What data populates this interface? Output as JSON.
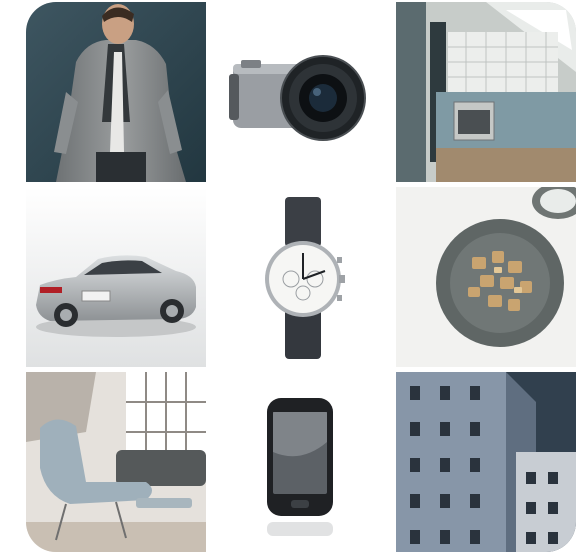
{
  "gallery": {
    "tiles": [
      {
        "subject": "man-in-cardigan"
      },
      {
        "subject": "mirrorless-camera"
      },
      {
        "subject": "kitchen-interior"
      },
      {
        "subject": "silver-sedan-car"
      },
      {
        "subject": "chronograph-wristwatch"
      },
      {
        "subject": "bowl-of-food"
      },
      {
        "subject": "lounge-chair-living-room"
      },
      {
        "subject": "smartphone"
      },
      {
        "subject": "apartment-building"
      }
    ]
  }
}
